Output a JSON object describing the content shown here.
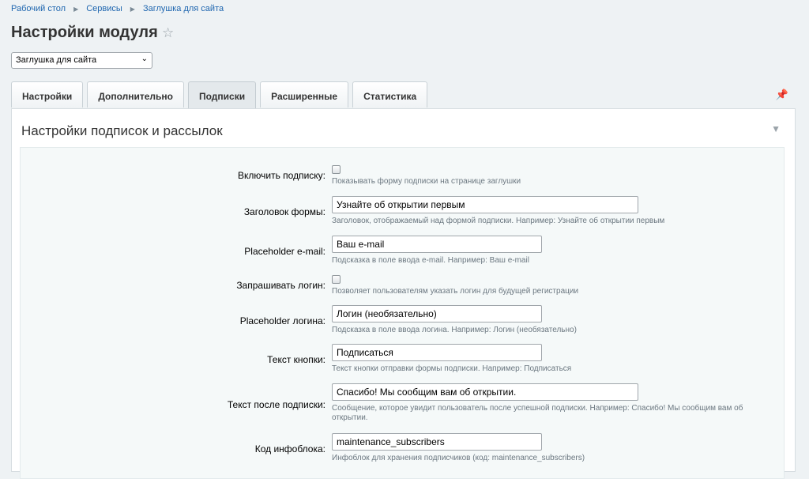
{
  "breadcrumb": [
    "Рабочий стол",
    "Сервисы",
    "Заглушка для сайта"
  ],
  "page_title": "Настройки модуля",
  "module_select": {
    "value": "Заглушка для сайта"
  },
  "tabs": [
    {
      "label": "Настройки"
    },
    {
      "label": "Дополнительно"
    },
    {
      "label": "Подписки",
      "active": true
    },
    {
      "label": "Расширенные"
    },
    {
      "label": "Статистика"
    }
  ],
  "section_title": "Настройки подписок и рассылок",
  "fields": {
    "enable": {
      "label": "Включить подписку:",
      "hint": "Показывать форму подписки на странице заглушки",
      "checked": false
    },
    "form_title": {
      "label": "Заголовок формы:",
      "value": "Узнайте об открытии первым",
      "hint": "Заголовок, отображаемый над формой подписки. Например: Узнайте об открытии первым"
    },
    "email_placeholder": {
      "label": "Placeholder e-mail:",
      "value": "Ваш e-mail",
      "hint": "Подсказка в поле ввода e-mail. Например: Ваш e-mail"
    },
    "ask_login": {
      "label": "Запрашивать логин:",
      "hint": "Позволяет пользователям указать логин для будущей регистрации",
      "checked": false
    },
    "login_placeholder": {
      "label": "Placeholder логина:",
      "value": "Логин (необязательно)",
      "hint": "Подсказка в поле ввода логина. Например: Логин (необязательно)"
    },
    "button_text": {
      "label": "Текст кнопки:",
      "value": "Подписаться",
      "hint": "Текст кнопки отправки формы подписки. Например: Подписаться"
    },
    "after_text": {
      "label": "Текст после подписки:",
      "value": "Спасибо! Мы сообщим вам об открытии.",
      "hint": "Сообщение, которое увидит пользователь после успешной подписки. Например: Спасибо! Мы сообщим вам об открытии."
    },
    "iblock_code": {
      "label": "Код инфоблока:",
      "value": "maintenance_subscribers",
      "hint": "Инфоблок для хранения подписчиков (код: maintenance_subscribers)"
    }
  }
}
